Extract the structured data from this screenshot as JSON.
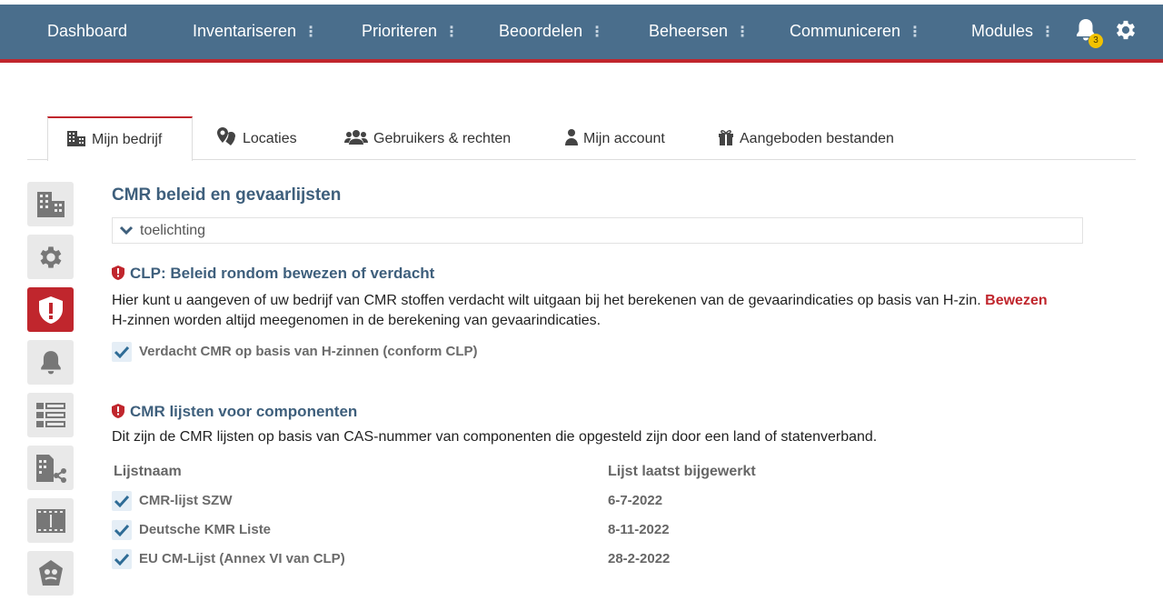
{
  "nav": {
    "items": [
      {
        "label": "Dashboard"
      },
      {
        "label": "Inventariseren",
        "dots": "⋮"
      },
      {
        "label": "Prioriteren",
        "dots": "⋮"
      },
      {
        "label": "Beoordelen",
        "dots": "⋮"
      },
      {
        "label": "Beheersen",
        "dots": "⋮"
      },
      {
        "label": "Communiceren",
        "dots": "⋮"
      },
      {
        "label": "Modules",
        "dots": "⋮"
      }
    ],
    "notification_count": "3",
    "icons": [
      "bell-icon",
      "gear-icon"
    ]
  },
  "tabs": [
    {
      "label": "Mijn bedrijf",
      "icon": "building-icon",
      "active": true
    },
    {
      "label": "Locaties",
      "icon": "map-pins-icon"
    },
    {
      "label": "Gebruikers & rechten",
      "icon": "users-icon"
    },
    {
      "label": "Mijn account",
      "icon": "user-icon"
    },
    {
      "label": "Aangeboden bestanden",
      "icon": "gift-icon"
    }
  ],
  "sidebar": {
    "icons": [
      "building-icon",
      "gear-icon",
      "shield-alert-icon",
      "bell-icon",
      "list-icon",
      "building-share-icon",
      "film-icon",
      "hazard-icon"
    ],
    "active_index": 2
  },
  "main": {
    "title": "CMR beleid en gevaarlijsten",
    "collapse_label": "toelichting",
    "clp": {
      "title": "CLP: Beleid rondom bewezen of verdacht",
      "text_before": "Hier kunt u aangeven of uw bedrijf van CMR stoffen verdacht wilt uitgaan bij het berekenen van de gevaarindicaties op basis van H-zin.",
      "text_highlight": "Bewezen",
      "text_after": "H-zinnen worden altijd meegenomen in de berekening van gevaarindicaties.",
      "checkbox_label": "Verdacht CMR op basis van H-zinnen (conform CLP)"
    },
    "lists": {
      "title": "CMR lijsten voor componenten",
      "description": "Dit zijn de CMR lijsten op basis van CAS-nummer van componenten die opgesteld zijn door een land of statenverband.",
      "col_name": "Lijstnaam",
      "col_date": "Lijst laatst bijgewerkt",
      "rows": [
        {
          "name": "CMR-lijst SZW",
          "date": "6-7-2022",
          "checked": true
        },
        {
          "name": "Deutsche KMR Liste",
          "date": "8-11-2022",
          "checked": true
        },
        {
          "name": "EU CM-Lijst (Annex VI van CLP)",
          "date": "28-2-2022",
          "checked": true
        }
      ]
    }
  },
  "colors": {
    "navbar": "#4a6e8c",
    "accent_red": "#c0262d",
    "heading_blue": "#3e5f7c",
    "badge_yellow": "#f2c200"
  }
}
